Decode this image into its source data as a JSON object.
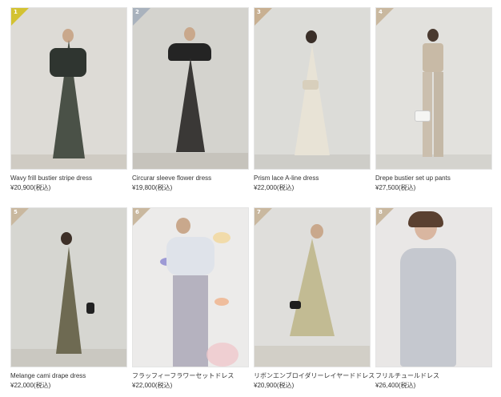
{
  "products": [
    {
      "rank": "1",
      "name": "Wavy frill bustier stripe dress",
      "price": "¥20,900(税込)"
    },
    {
      "rank": "2",
      "name": "Circurar sleeve flower dress",
      "price": "¥19,800(税込)"
    },
    {
      "rank": "3",
      "name": "Prism lace A-line dress",
      "price": "¥22,000(税込)"
    },
    {
      "rank": "4",
      "name": "Drepe bustier set up pants",
      "price": "¥27,500(税込)"
    },
    {
      "rank": "5",
      "name": "Melange cami drape dress",
      "price": "¥22,000(税込)"
    },
    {
      "rank": "6",
      "name": "フラッフィーフラワーセットドレス",
      "price": "¥22,000(税込)"
    },
    {
      "rank": "7",
      "name": "リボンエンブロイダリーレイヤードドレス",
      "price": "¥20,900(税込)"
    },
    {
      "rank": "8",
      "name": "フリルチュールドレス",
      "price": "¥26,400(税込)"
    }
  ],
  "colors": {
    "rank_gold": "#d3c232",
    "rank_silver": "#a9b2bd",
    "rank_bronze": "#c8b092",
    "rank_default": "#c9b89f"
  }
}
